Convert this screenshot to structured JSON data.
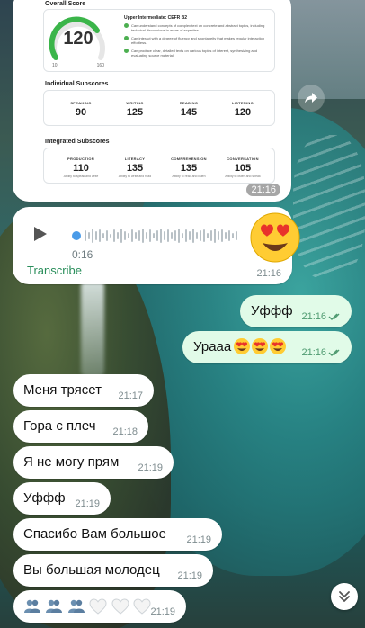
{
  "certificate": {
    "overall_title": "Overall Score",
    "overall_score": "120",
    "gauge_min": "10",
    "gauge_max": "160",
    "gauge_fill_fraction": 0.73,
    "level_title": "Upper Intermediate: CEFR B2",
    "level_points": [
      "Can understand concepts of complex text on concrete and abstract topics, including technical discussions in areas of expertise.",
      "Can interact with a degree of fluency and spontaneity that makes regular interaction effortless.",
      "Can produce clear, detailed texts on various topics of interest, synthesizing and evaluating source material."
    ],
    "individual_title": "Individual Subscores",
    "individual": [
      {
        "name": "SPEAKING",
        "value": "90"
      },
      {
        "name": "WRITING",
        "value": "125"
      },
      {
        "name": "READING",
        "value": "145"
      },
      {
        "name": "LISTENING",
        "value": "120"
      }
    ],
    "integrated_title": "Integrated Subscores",
    "integrated": [
      {
        "name": "PRODUCTION",
        "value": "110",
        "desc": "Ability to speak and write"
      },
      {
        "name": "LITERACY",
        "value": "135",
        "desc": "Ability to write and read"
      },
      {
        "name": "COMPREHENSION",
        "value": "135",
        "desc": "Ability to read and listen"
      },
      {
        "name": "CONVERSATION",
        "value": "105",
        "desc": "Ability to listen and speak"
      }
    ],
    "time": "21:16"
  },
  "voice": {
    "duration": "0:16",
    "transcribe_label": "Transcribe",
    "time": "21:16",
    "reaction_icon": "heart-eyes-emoji"
  },
  "outgoing": [
    {
      "text": "Уффф",
      "time": "21:16"
    },
    {
      "text": "Урааа",
      "emojis": 3,
      "time": "21:16"
    }
  ],
  "incoming": [
    {
      "text": "Меня трясет",
      "time": "21:17"
    },
    {
      "text": "Гора с плеч",
      "time": "21:18"
    },
    {
      "text": "Я не могу прям",
      "time": "21:19"
    },
    {
      "text": "Уффф",
      "time": "21:19"
    },
    {
      "text": "Спасибо Вам большое",
      "time": "21:19"
    },
    {
      "text": "Вы большая молодец",
      "time": "21:19"
    },
    {
      "text": "",
      "emoji_row": "people-and-white-hearts",
      "time": "21:19"
    }
  ],
  "colors": {
    "outgoing_bubble": "#e1fbe8",
    "incoming_bubble": "#ffffff",
    "gauge_green": "#3bb54a",
    "accent": "#2a8e5b"
  }
}
